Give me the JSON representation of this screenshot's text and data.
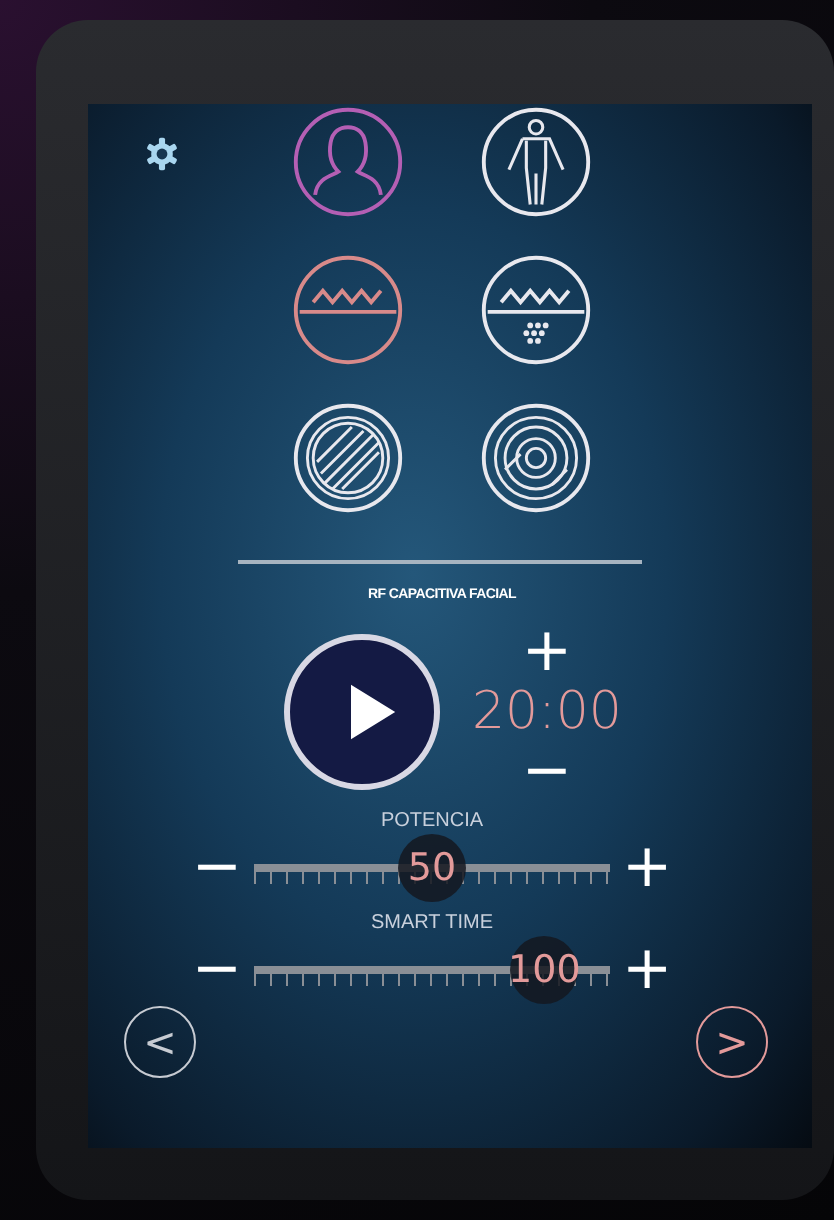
{
  "modes": [
    {
      "kind": "face",
      "color": "#b45fb4"
    },
    {
      "kind": "body",
      "color": "#e8e8ee"
    },
    {
      "kind": "wave",
      "color": "#d88a8a"
    },
    {
      "kind": "wave-dots",
      "color": "#e8e8ee"
    },
    {
      "kind": "disc",
      "color": "#e8e8ee"
    },
    {
      "kind": "rings",
      "color": "#e8e8ee"
    }
  ],
  "treatment_title": "RF CAPACITIVA FACIAL",
  "timer": {
    "increase": "+",
    "value": "20:00",
    "decrease": "−"
  },
  "sliders": [
    {
      "label": "POTENCIA",
      "decrease": "−",
      "increase": "+",
      "reading": "50",
      "level": 0.5
    },
    {
      "label": "SMART TIME",
      "decrease": "−",
      "increase": "+",
      "reading": "100",
      "level": 0.89
    }
  ],
  "nav": {
    "previous": "<",
    "next": ">"
  }
}
